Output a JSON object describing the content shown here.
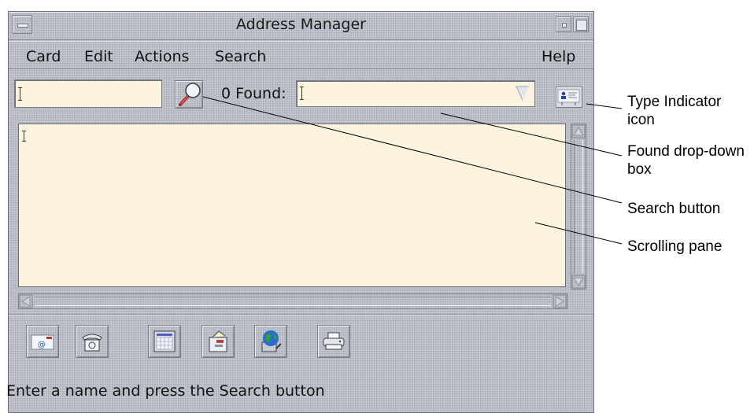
{
  "window": {
    "title": "Address Manager"
  },
  "menubar": {
    "items": [
      "Card",
      "Edit",
      "Actions",
      "Search"
    ],
    "help": "Help"
  },
  "toolbar": {
    "search_value": "",
    "found_label": "0 Found:",
    "found_value": ""
  },
  "pane": {
    "content": ""
  },
  "action_buttons": [
    {
      "icon": "email-card-icon"
    },
    {
      "icon": "telephone-icon"
    },
    {
      "icon": "calendar-icon"
    },
    {
      "icon": "file-cabinet-icon"
    },
    {
      "icon": "web-globe-icon"
    },
    {
      "icon": "printer-icon"
    }
  ],
  "status": {
    "message": "Enter a name and press the Search button"
  },
  "callouts": {
    "type_indicator": "Type Indicator icon",
    "found_dropdown": "Found drop-down box",
    "search_button": "Search button",
    "scrolling_pane": "Scrolling pane"
  },
  "colors": {
    "window_bg": "#b9bdc6",
    "field_bg": "#fbf3dd",
    "text": "#111111"
  }
}
